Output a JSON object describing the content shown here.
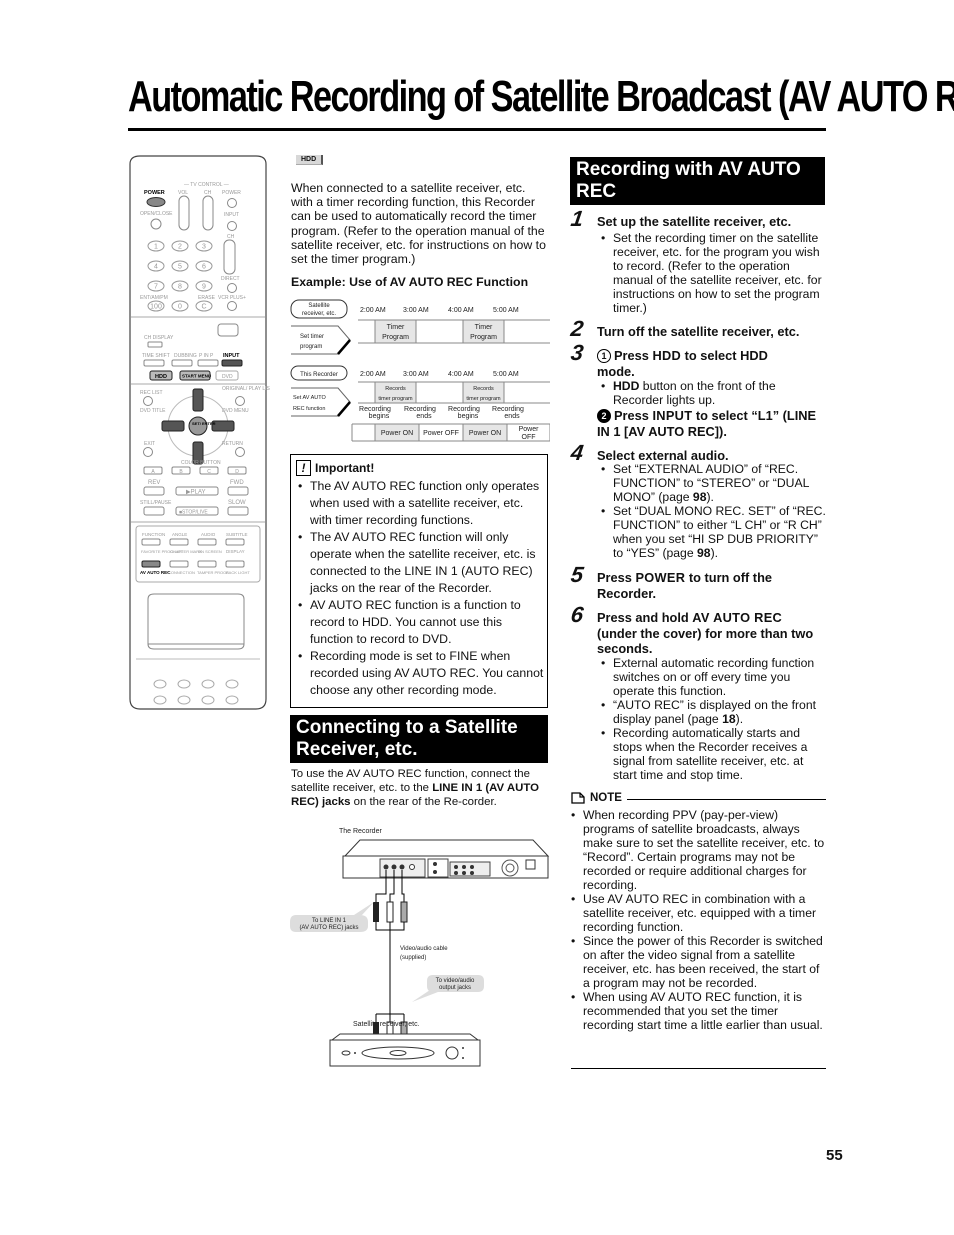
{
  "page": {
    "title": "Automatic Recording of Satellite Broadcast (AV AUTO REC)",
    "page_number": "55"
  },
  "remote": {
    "labels": {
      "tv_control": "— TV CONTROL —",
      "power": "POWER",
      "vol": "VOL",
      "ch": "CH",
      "tv_power": "POWER",
      "open_close": "OPEN/CLOSE",
      "input": "INPUT",
      "ch2": "CH",
      "direct": "DIRECT",
      "ent_am_pm": "ENT/AM/PM",
      "erase": "ERASE",
      "vcr_plus": "VCR PLUS+",
      "ch_display": "CH DISPLAY",
      "time_shift": "TIME SHIFT",
      "dubbing": "DUBBING",
      "pinp": "P IN P",
      "input2": "INPUT",
      "hdd": "HDD",
      "start_menu": "START MENU",
      "dvd": "DVD",
      "rec_list": "REC LIST",
      "original_play_list": "ORIGINAL/ PLAY LIST",
      "dvd_title": "DVD TITLE",
      "dvd_menu": "DVD MENU",
      "set_enter": "SET/ ENTER",
      "exit": "EXIT",
      "return": "RETURN",
      "color_button": "COLOR BUTTON",
      "rev": "REV",
      "fwd": "FWD",
      "play": "▶PLAY",
      "still_pause": "STILL/PAUSE",
      "slow": "SLOW",
      "stop_live": "■STOP/LIVE",
      "function": "FUNCTION",
      "angle": "ANGLE",
      "audio": "AUDIO",
      "subtitle": "SUBTITLE",
      "favorite": "FAVORITE PROG.LIST",
      "chapter_mark": "CHAPTER MARK",
      "on_screen": "ON SCREEN",
      "display": "DISPLAY",
      "av_auto_rec": "AV AUTO REC",
      "connection": "CONNECTION",
      "tamper_proof": "TAMPER PROOF",
      "back_light": "BACK LIGHT"
    },
    "number_keys": [
      "1",
      "2",
      "3",
      "4",
      "5",
      "6",
      "7",
      "8",
      "9",
      "100",
      "0",
      "C"
    ],
    "color_keys": [
      "A",
      "B",
      "C",
      "D"
    ]
  },
  "intro": {
    "badge": "HDD",
    "paragraph": "When connected to a satellite receiver, etc. with a timer recording function, this Recorder can be used to automatically record the timer program. (Refer to the operation manual of the satellite receiver, etc. for instructions on how to set the timer program.)",
    "example_heading": "Example: Use of AV AUTO REC Function"
  },
  "timing_diagram": {
    "times": [
      "2:00 AM",
      "3:00 AM",
      "4:00 AM",
      "5:00 AM"
    ],
    "satellite": {
      "label": "Satellite receiver, etc.",
      "action": "Set timer program",
      "blocks": [
        "Timer Program",
        "Timer Program"
      ]
    },
    "recorder": {
      "label": "This Recorder",
      "action": "Set AV AUTO REC function",
      "blocks": [
        "Records timer program",
        "Records timer program"
      ],
      "events": [
        "Recording begins",
        "Recording ends",
        "Recording begins",
        "Recording ends"
      ],
      "power_states": [
        "Power ON",
        "Power OFF",
        "Power ON",
        "Power OFF"
      ]
    }
  },
  "important": {
    "heading": "Important!",
    "items": [
      "The AV AUTO REC function only operates when used with a satellite receiver, etc. with timer recording functions.",
      "The AV AUTO REC function will only operate when the satellite receiver, etc. is connected to the LINE IN 1 (AUTO REC) jacks on the rear of the Recorder.",
      "AV AUTO REC function is a function to record to HDD. You cannot use this function to record to DVD.",
      "Recording mode is set to FINE when recorded using AV AUTO REC. You cannot choose any other recording mode."
    ]
  },
  "connecting": {
    "heading": "Connecting to a Satellite Receiver, etc.",
    "text_before": "To use the AV AUTO REC function, connect the satellite receiver, etc. to the ",
    "text_bold": "LINE IN 1 (AV AUTO REC) jacks",
    "text_after": " on the rear of the Re-corder.",
    "diagram": {
      "recorder_label": "The Recorder",
      "callout_line_in_1": "To LINE IN 1",
      "callout_line_in_2": "(AV AUTO REC) jacks",
      "cable_label_1": "Video/audio cable",
      "cable_label_2": "(supplied)",
      "callout_output_1": "To video/audio",
      "callout_output_2": "output jacks",
      "receiver_label": "Satellite receiver, etc."
    }
  },
  "recording": {
    "heading": "Recording with AV AUTO REC",
    "steps": [
      {
        "num": "1",
        "title": "Set up the satellite receiver, etc.",
        "bullets": [
          "Set the recording timer on the satellite receiver, etc. for the program you wish to record. (Refer to the operation manual of the satellite receiver, etc. for instructions on how to set the program timer.)"
        ]
      },
      {
        "num": "2",
        "title": "Turn off the satellite receiver, etc."
      },
      {
        "num": "3",
        "sub1_num": "1",
        "sub1_pre": "Press ",
        "sub1_key": "HDD",
        "sub1_post": " to select HDD mode.",
        "sub1_bullet_key": "HDD",
        "sub1_bullet_text": " button on the front of the Recorder lights up.",
        "sub2_num": "2",
        "sub2_pre": "Press ",
        "sub2_key": "INPUT",
        "sub2_post": " to select “L1” (LINE IN 1 [AV AUTO REC])."
      },
      {
        "num": "4",
        "title": "Select external audio.",
        "b1_text": "Set “EXTERNAL AUDIO” of “REC. FUNCTION” to “STEREO” or “DUAL MONO” (page ",
        "b1_page": "98",
        "b1_end": ").",
        "b2_text": "Set “DUAL MONO REC. SET” of “REC. FUNCTION” to either “L CH” or “R CH” when you set “HI SP DUB PRIORITY” to “YES” (page ",
        "b2_page": "98",
        "b2_end": ")."
      },
      {
        "num": "5",
        "pre": "Press ",
        "key": "POWER",
        "post": " to turn off the Recorder."
      },
      {
        "num": "6",
        "pre": "Press and hold ",
        "key": "AV AUTO REC",
        "post": " (under the cover) for more than two seconds.",
        "b1": "External automatic recording function switches on or off every time you operate this function.",
        "b2_text": "“AUTO REC” is displayed on the front display panel (page ",
        "b2_page": "18",
        "b2_end": ").",
        "b3": "Recording automatically starts and stops when the Recorder receives a signal from satellite receiver, etc. at start time and stop time."
      }
    ]
  },
  "note": {
    "heading": "NOTE",
    "items": [
      "When recording PPV (pay-per-view) programs of satellite broadcasts, always make sure to set the satellite receiver, etc. to “Record”. Certain programs may not be recorded or require additional charges for recording.",
      "Use AV AUTO REC in combination with a satellite receiver, etc. equipped with a timer recording function.",
      "Since the power of this Recorder is switched on after the video signal from a satellite receiver, etc. has been received, the start of a program may not be recorded.",
      "When using AV AUTO REC function, it is recommended that you set the timer recording start time a little earlier than usual."
    ]
  }
}
